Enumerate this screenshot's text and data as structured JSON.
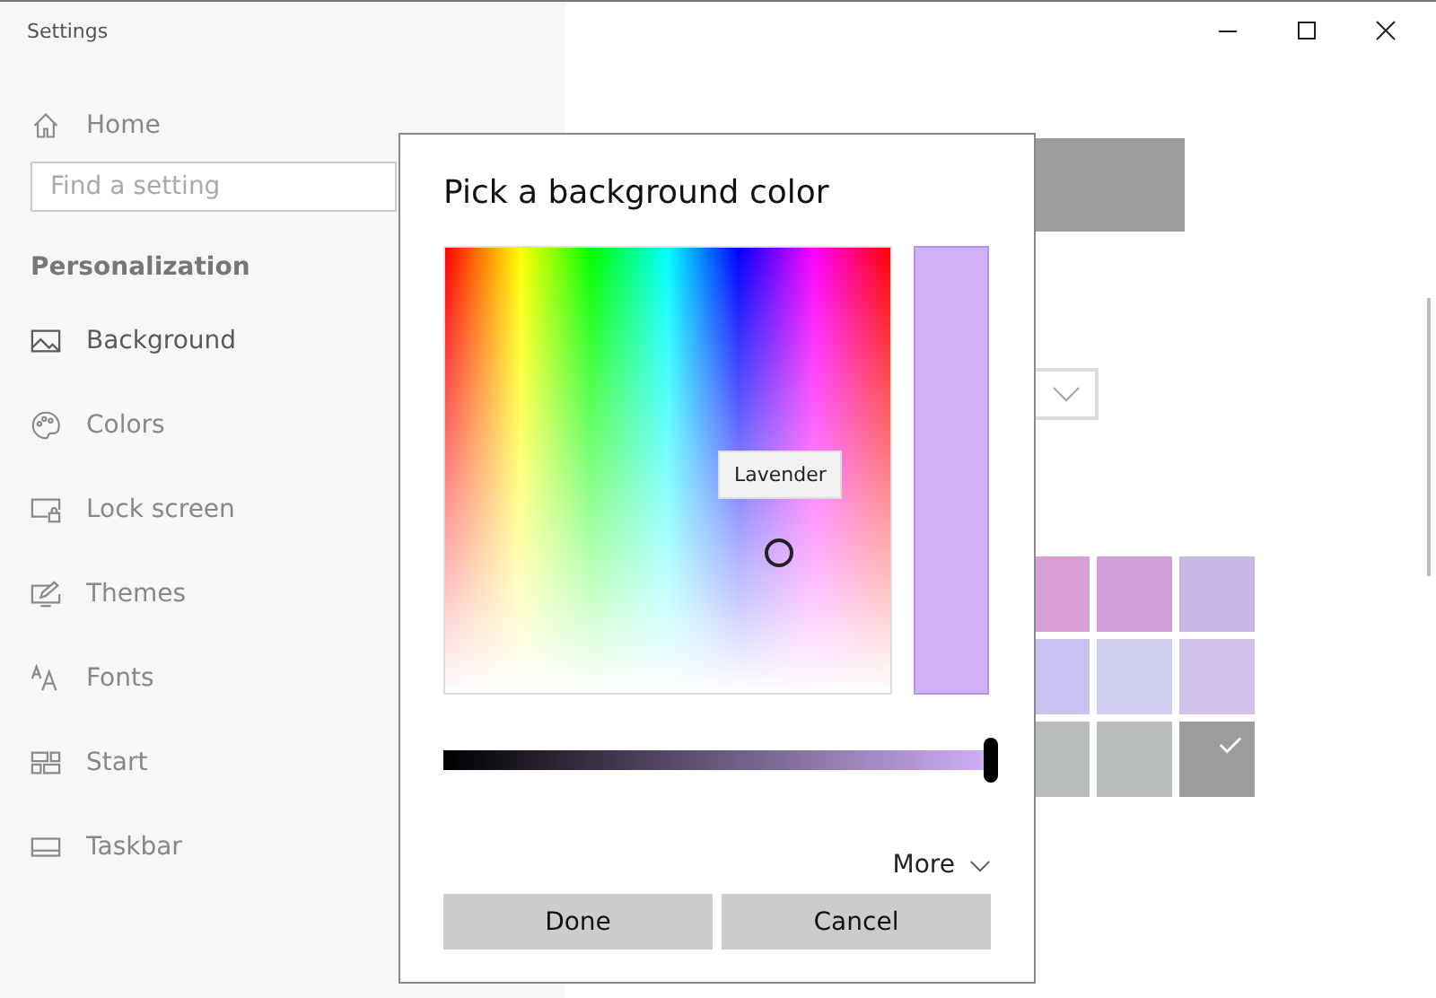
{
  "window": {
    "title": "Settings"
  },
  "sidebar": {
    "home": "Home",
    "search": {
      "placeholder": "Find a setting"
    },
    "section": "Personalization",
    "items": [
      {
        "label": "Background",
        "selected": true
      },
      {
        "label": "Colors",
        "selected": false
      },
      {
        "label": "Lock screen",
        "selected": false
      },
      {
        "label": "Themes",
        "selected": false
      },
      {
        "label": "Fonts",
        "selected": false
      },
      {
        "label": "Start",
        "selected": false
      },
      {
        "label": "Taskbar",
        "selected": false
      }
    ]
  },
  "page": {
    "swatches": [
      {
        "color": "#d8a0d4",
        "selected": false
      },
      {
        "color": "#d0a0d8",
        "selected": false
      },
      {
        "color": "#c9b6e2",
        "selected": false
      },
      {
        "color": "#c8c2f0",
        "selected": false
      },
      {
        "color": "#d2d0ef",
        "selected": false
      },
      {
        "color": "#d0c2e8",
        "selected": false
      },
      {
        "color": "#b8bcbc",
        "selected": false
      },
      {
        "color": "#b8bcbc",
        "selected": false
      },
      {
        "color": "#9c9c9c",
        "selected": true
      }
    ]
  },
  "dialog": {
    "title": "Pick a background color",
    "tooltip": "Lavender",
    "brightness": {
      "level": 1.0
    },
    "more": "More",
    "buttons": [
      "Done",
      "Cancel"
    ]
  }
}
